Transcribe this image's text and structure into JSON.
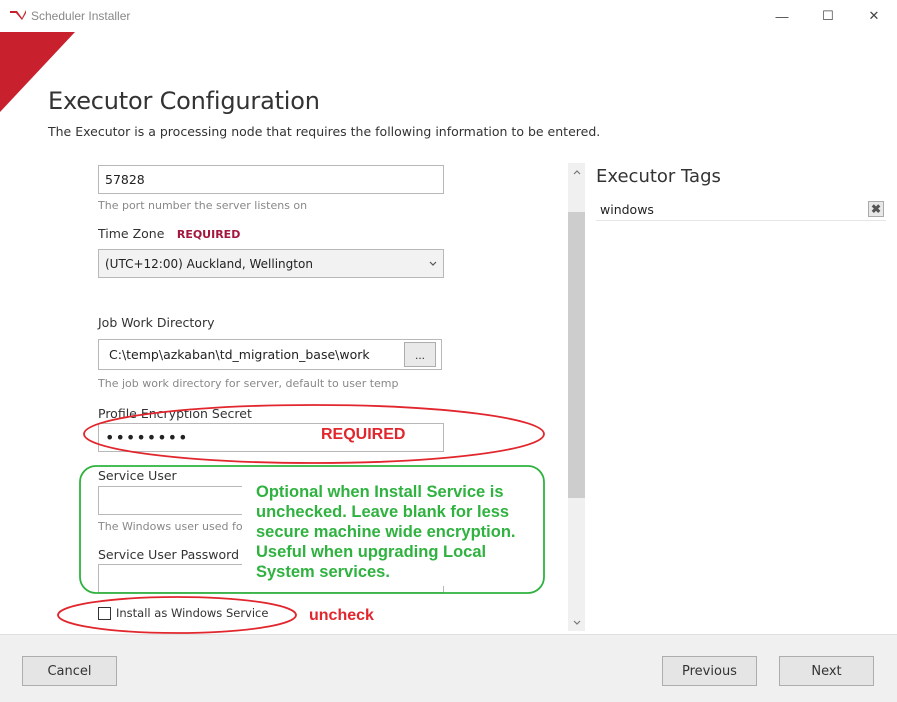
{
  "window": {
    "title": "Scheduler Installer",
    "minimize_glyph": "—",
    "maximize_glyph": "☐",
    "close_glyph": "✕"
  },
  "header": {
    "title": "Executor Configuration",
    "subtitle": "The Executor is a processing node that requires the following information to be entered."
  },
  "form": {
    "port": {
      "value": "57828",
      "hint": "The port number the server listens on"
    },
    "time_zone": {
      "label": "Time Zone",
      "required_label": "REQUIRED",
      "selected": "(UTC+12:00) Auckland, Wellington"
    },
    "job_work_directory": {
      "label": "Job Work Directory",
      "value": "C:\\temp\\azkaban\\td_migration_base\\work",
      "browse_label": "...",
      "hint": "The job work directory for server, default to user temp"
    },
    "profile_encryption_secret": {
      "label": "Profile Encryption Secret",
      "value": "••••••••"
    },
    "service_user": {
      "label": "Service User",
      "value": "",
      "hint": "The Windows user used for"
    },
    "service_user_password": {
      "label": "Service User Password",
      "value": ""
    },
    "install_as_service": {
      "label": "Install as Windows Service",
      "checked": false
    }
  },
  "tags": {
    "title": "Executor Tags",
    "items": [
      "windows"
    ],
    "remove_glyph": "✖"
  },
  "annotations": {
    "required": "REQUIRED",
    "optional_lines": [
      "Optional when Install Service is",
      "unchecked. Leave blank for less",
      "secure machine wide encryption.",
      "Useful when upgrading Local",
      "System services."
    ],
    "uncheck": "uncheck",
    "red_color": "#e1262d",
    "green_color": "#2fb23f"
  },
  "footer": {
    "cancel_label": "Cancel",
    "previous_label": "Previous",
    "next_label": "Next"
  },
  "colors": {
    "accent": "#c8202c",
    "required": "#a3163e"
  },
  "icons": {
    "app": "app-logo-icon",
    "dropdown": "chevron-down-icon",
    "scroll_up": "chevron-up-icon",
    "scroll_down": "chevron-down-icon"
  }
}
